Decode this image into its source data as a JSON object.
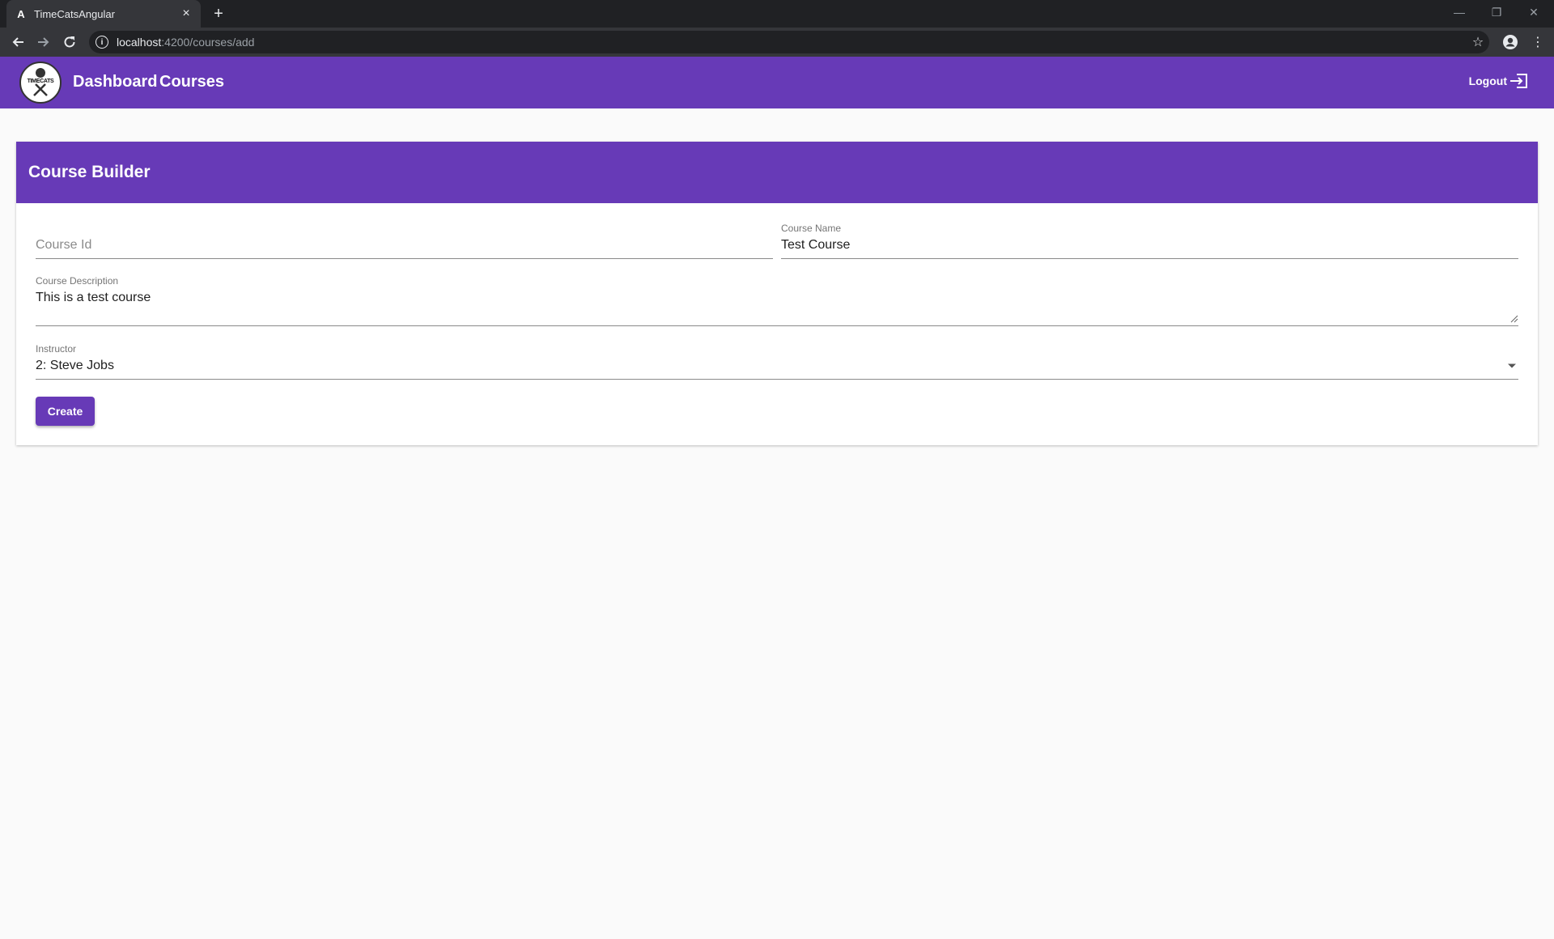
{
  "browser": {
    "tab_title": "TimeCatsAngular",
    "tab_favicon": "A",
    "url_host": "localhost",
    "url_path": ":4200/courses/add"
  },
  "header": {
    "nav": [
      "Dashboard",
      "Courses"
    ],
    "logout_label": "Logout",
    "logo_text": "TIMECATS"
  },
  "card": {
    "title": "Course Builder"
  },
  "form": {
    "course_id": {
      "placeholder": "Course Id",
      "value": ""
    },
    "course_name": {
      "label": "Course Name",
      "value": "Test Course"
    },
    "course_description": {
      "label": "Course Description",
      "value": "This is a test course"
    },
    "instructor": {
      "label": "Instructor",
      "value": "2: Steve Jobs"
    },
    "create_label": "Create"
  },
  "colors": {
    "primary": "#673ab7",
    "chrome_dark": "#202124",
    "chrome_tab": "#35363a"
  }
}
